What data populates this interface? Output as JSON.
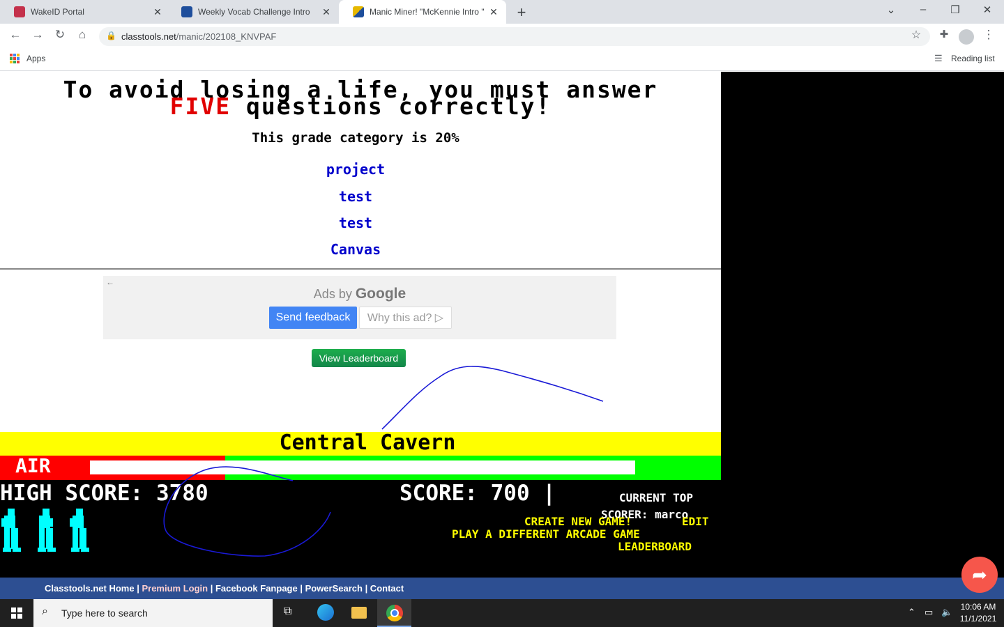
{
  "browser": {
    "tabs": [
      {
        "title": "WakeID Portal",
        "color": "#c4314b"
      },
      {
        "title": "Weekly Vocab Challenge Intro",
        "color": "#1e4e9c"
      },
      {
        "title": "Manic Miner! \"McKennie Intro \"",
        "color": "#e6b800"
      }
    ],
    "url_host": "classtools.net",
    "url_path": "/manic/202108_KNVPAF",
    "bookmarks_apps": "Apps",
    "reading_list": "Reading list"
  },
  "quiz": {
    "warning_line1": "To avoid losing a life, you must answer",
    "warning_red": "FIVE",
    "warning_line2": " questions correctly!",
    "grade_text": "This grade category is 20%",
    "options": [
      "project",
      "test",
      "test",
      "Canvas"
    ]
  },
  "ads": {
    "ads_by": "Ads by",
    "google": "Google",
    "send_feedback": "Send feedback",
    "why_this_ad": "Why this ad? ▷"
  },
  "leaderboard_button": "View Leaderboard",
  "game": {
    "level_name": "Central Cavern",
    "air_label": "AIR",
    "air_level": 0.4,
    "high_score": "HIGH SCORE: 3780",
    "score": "SCORE: 700 |",
    "current_top": "CURRENT TOP",
    "scorer": "SCORER: marco",
    "create_new": "CREATE NEW GAME!",
    "edit": "EDIT",
    "play_different": "PLAY A DIFFERENT ARCADE GAME",
    "leaderboard": "LEADERBOARD",
    "lives": 3
  },
  "footer": {
    "home": "Classtools.net Home |",
    "premium": "Premium Login",
    "rest": "| Facebook Fanpage | PowerSearch | Contact"
  },
  "taskbar": {
    "search_placeholder": "Type here to search",
    "time": "10:06 AM",
    "date": "11/1/2021"
  }
}
